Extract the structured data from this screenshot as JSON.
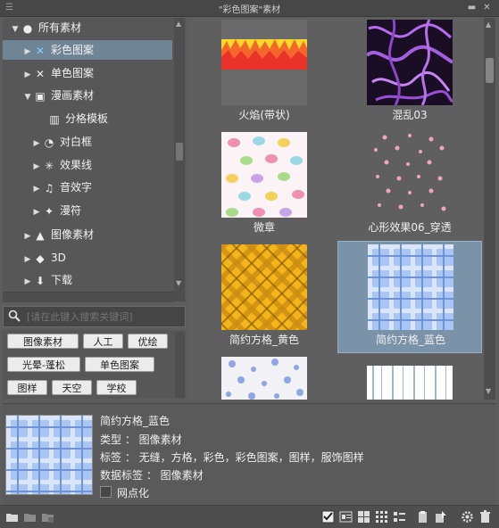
{
  "window": {
    "title": "\"彩色图案\"素材"
  },
  "tree": {
    "items": [
      {
        "label": "所有素材",
        "icon": "globe-icon",
        "expanded": true
      },
      {
        "label": "彩色图案",
        "icon": "color-pattern-icon",
        "selected": true
      },
      {
        "label": "单色图案",
        "icon": "mono-pattern-icon"
      },
      {
        "label": "漫画素材",
        "icon": "manga-material-icon",
        "expanded": true
      },
      {
        "label": "分格模板",
        "icon": "frame-template-icon"
      },
      {
        "label": "对白框",
        "icon": "balloon-icon"
      },
      {
        "label": "效果线",
        "icon": "effect-lines-icon"
      },
      {
        "label": "音效字",
        "icon": "sound-effect-icon"
      },
      {
        "label": "漫符",
        "icon": "manga-symbol-icon"
      },
      {
        "label": "图像素材",
        "icon": "image-material-icon"
      },
      {
        "label": "3D",
        "icon": "3d-icon"
      },
      {
        "label": "下载",
        "icon": "download-icon"
      }
    ]
  },
  "search": {
    "placeholder": "[请在此键入搜索关键词]"
  },
  "tags": [
    "图像素材",
    "人工",
    "优绘",
    "光晕-蓬松",
    "单色图案",
    "图样",
    "天空",
    "学校"
  ],
  "materials": [
    {
      "name": "火焰(带状)",
      "thumb": "fire"
    },
    {
      "name": "混乱03",
      "thumb": "chaos"
    },
    {
      "name": "微章",
      "thumb": "macaron"
    },
    {
      "name": "心形效果06_穿透",
      "thumb": "hearts"
    },
    {
      "name": "简约方格_黄色",
      "thumb": "yellow-plaid"
    },
    {
      "name": "简约方格_蓝色",
      "thumb": "blue-plaid",
      "selected": true
    },
    {
      "name": "",
      "thumb": "flowers"
    },
    {
      "name": "",
      "thumb": "streaks"
    }
  ],
  "details": {
    "name": "简约方格_蓝色",
    "type_line": "类型 ： 图像素材",
    "tags_line": "标签 ： 无缝，方格，彩色，彩色图案，图样，服饰图样",
    "data_tags_line": "数据标签 ： 图像素材",
    "halftone_label": "网点化"
  },
  "colors": {
    "accent_selected": "#6f8596",
    "panel_bg": "#5d5d5d"
  }
}
